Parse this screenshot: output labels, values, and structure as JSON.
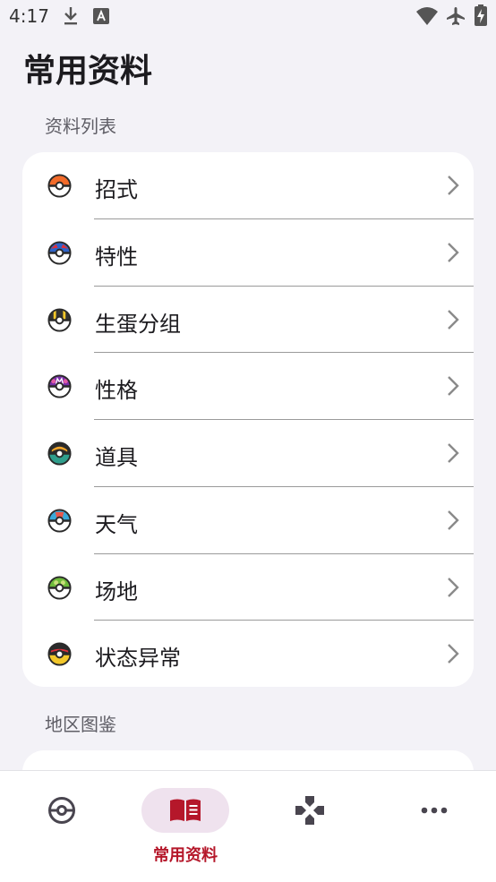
{
  "status_bar": {
    "time": "4:17"
  },
  "page": {
    "title": "常用资料"
  },
  "sections": [
    {
      "label": "资料列表",
      "items": [
        {
          "label": "招式",
          "icon": "poke-ball-icon"
        },
        {
          "label": "特性",
          "icon": "great-ball-icon"
        },
        {
          "label": "生蛋分组",
          "icon": "ultra-ball-icon"
        },
        {
          "label": "性格",
          "icon": "master-ball-icon"
        },
        {
          "label": "道具",
          "icon": "dusk-ball-icon"
        },
        {
          "label": "天气",
          "icon": "dive-ball-icon"
        },
        {
          "label": "场地",
          "icon": "friend-ball-icon"
        },
        {
          "label": "状态异常",
          "icon": "luxury-ball-icon"
        }
      ]
    },
    {
      "label": "地区图鉴"
    }
  ],
  "bottom_nav": {
    "items": [
      {
        "icon": "pokeball-outline-icon"
      },
      {
        "label": "常用资料",
        "icon": "book-icon",
        "active": true
      },
      {
        "icon": "gamepad-icon"
      },
      {
        "icon": "more-dots-icon"
      }
    ]
  },
  "colors": {
    "accent": "#b5172a",
    "active_pill": "#efe2ee",
    "background": "#f3f2f7"
  }
}
